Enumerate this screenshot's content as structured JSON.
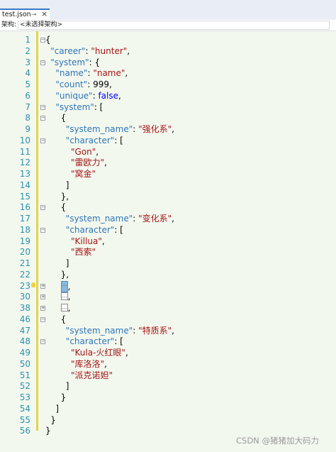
{
  "tab": {
    "title": "test.json",
    "pin_icon": "pin-icon",
    "close_icon": "close-icon"
  },
  "navbar": {
    "label": "架构:",
    "selector_value": "<未选择架构>"
  },
  "lines": [
    {
      "num": "1",
      "fold": "⊟",
      "tokens": [
        {
          "t": "{",
          "c": "n"
        }
      ]
    },
    {
      "num": "2",
      "tokens": [
        {
          "t": "\"career\"",
          "c": "k"
        },
        {
          "t": ": ",
          "c": "n"
        },
        {
          "t": "\"hunter\"",
          "c": "s"
        },
        {
          "t": ",",
          "c": "n"
        }
      ]
    },
    {
      "num": "3",
      "fold": "⊟",
      "tokens": [
        {
          "t": "\"system\"",
          "c": "k"
        },
        {
          "t": ": {",
          "c": "n"
        }
      ]
    },
    {
      "num": "4",
      "tokens": [
        {
          "t": "\"name\"",
          "c": "k"
        },
        {
          "t": ": ",
          "c": "n"
        },
        {
          "t": "\"name\"",
          "c": "s"
        },
        {
          "t": ",",
          "c": "n"
        }
      ]
    },
    {
      "num": "5",
      "tokens": [
        {
          "t": "\"count\"",
          "c": "k"
        },
        {
          "t": ": 999,",
          "c": "n"
        }
      ]
    },
    {
      "num": "6",
      "tokens": [
        {
          "t": "\"unique\"",
          "c": "k"
        },
        {
          "t": ": ",
          "c": "n"
        },
        {
          "t": "false",
          "c": "b"
        },
        {
          "t": ",",
          "c": "n"
        }
      ]
    },
    {
      "num": "7",
      "fold": "⊟",
      "tokens": [
        {
          "t": "\"system\"",
          "c": "k"
        },
        {
          "t": ": [",
          "c": "n"
        }
      ]
    },
    {
      "num": "8",
      "fold": "⊟",
      "tokens": [
        {
          "t": "{",
          "c": "n"
        }
      ]
    },
    {
      "num": "9",
      "tokens": [
        {
          "t": "\"system_name\"",
          "c": "k"
        },
        {
          "t": ": ",
          "c": "n"
        },
        {
          "t": "\"强化系\"",
          "c": "s"
        },
        {
          "t": ",",
          "c": "n"
        }
      ]
    },
    {
      "num": "10",
      "fold": "⊟",
      "tokens": [
        {
          "t": "\"character\"",
          "c": "k"
        },
        {
          "t": ": [",
          "c": "n"
        }
      ]
    },
    {
      "num": "11",
      "tokens": [
        {
          "t": "\"Gon\"",
          "c": "s"
        },
        {
          "t": ",",
          "c": "n"
        }
      ]
    },
    {
      "num": "12",
      "tokens": [
        {
          "t": "\"雷欧力\"",
          "c": "s"
        },
        {
          "t": ",",
          "c": "n"
        }
      ]
    },
    {
      "num": "13",
      "tokens": [
        {
          "t": "\"窝金\"",
          "c": "s"
        }
      ]
    },
    {
      "num": "14",
      "tokens": [
        {
          "t": "]",
          "c": "n"
        }
      ]
    },
    {
      "num": "15",
      "tokens": [
        {
          "t": "},",
          "c": "n"
        }
      ]
    },
    {
      "num": "16",
      "fold": "⊟",
      "tokens": [
        {
          "t": "{",
          "c": "n"
        }
      ]
    },
    {
      "num": "17",
      "tokens": [
        {
          "t": "\"system_name\"",
          "c": "k"
        },
        {
          "t": ": ",
          "c": "n"
        },
        {
          "t": "\"变化系\"",
          "c": "s"
        },
        {
          "t": ",",
          "c": "n"
        }
      ]
    },
    {
      "num": "18",
      "fold": "⊟",
      "tokens": [
        {
          "t": "\"character\"",
          "c": "k"
        },
        {
          "t": ": [",
          "c": "n"
        }
      ]
    },
    {
      "num": "19",
      "tokens": [
        {
          "t": "\"Killua\"",
          "c": "s"
        },
        {
          "t": ",",
          "c": "n"
        }
      ]
    },
    {
      "num": "20",
      "tokens": [
        {
          "t": "\"西索\"",
          "c": "s"
        }
      ]
    },
    {
      "num": "21",
      "tokens": [
        {
          "t": "]",
          "c": "n"
        }
      ]
    },
    {
      "num": "22",
      "tokens": [
        {
          "t": "},",
          "c": "n"
        }
      ]
    },
    {
      "num": "23",
      "fold": "⊞",
      "tokens": [
        {
          "t": "…",
          "c": "collapsed-sel"
        },
        {
          "t": ",",
          "c": "n"
        }
      ]
    },
    {
      "num": "30",
      "fold": "⊞",
      "tokens": [
        {
          "t": "…",
          "c": "collapsed"
        },
        {
          "t": ",",
          "c": "n"
        }
      ]
    },
    {
      "num": "38",
      "fold": "⊞",
      "tokens": [
        {
          "t": "…",
          "c": "collapsed"
        },
        {
          "t": ",",
          "c": "n"
        }
      ]
    },
    {
      "num": "46",
      "fold": "⊟",
      "tokens": [
        {
          "t": "{",
          "c": "n"
        }
      ]
    },
    {
      "num": "47",
      "tokens": [
        {
          "t": "\"system_name\"",
          "c": "k"
        },
        {
          "t": ": ",
          "c": "n"
        },
        {
          "t": "\"特质系\"",
          "c": "s"
        },
        {
          "t": ",",
          "c": "n"
        }
      ]
    },
    {
      "num": "48",
      "fold": "⊟",
      "tokens": [
        {
          "t": "\"character\"",
          "c": "k"
        },
        {
          "t": ": [",
          "c": "n"
        }
      ]
    },
    {
      "num": "49",
      "tokens": [
        {
          "t": "\"Kula-火红眼\"",
          "c": "s"
        },
        {
          "t": ",",
          "c": "n"
        }
      ]
    },
    {
      "num": "50",
      "tokens": [
        {
          "t": "\"库洛洛\"",
          "c": "s"
        },
        {
          "t": ",",
          "c": "n"
        }
      ]
    },
    {
      "num": "51",
      "tokens": [
        {
          "t": "\"派克诺妲\"",
          "c": "s"
        }
      ]
    },
    {
      "num": "52",
      "tokens": [
        {
          "t": "]",
          "c": "n"
        }
      ]
    },
    {
      "num": "53",
      "tokens": [
        {
          "t": "}",
          "c": "n"
        }
      ]
    },
    {
      "num": "54",
      "tokens": [
        {
          "t": "]",
          "c": "n"
        }
      ]
    },
    {
      "num": "55",
      "tokens": [
        {
          "t": "}",
          "c": "n"
        }
      ]
    },
    {
      "num": "56",
      "tokens": [
        {
          "t": "}",
          "c": "n"
        }
      ]
    }
  ],
  "watermark": "CSDN @猪猪加大码力",
  "colors": {
    "key": "#2e75b6",
    "string": "#a31515",
    "keyword": "#0000ff",
    "line_number": "#2b91af",
    "background": "#f3f8ef"
  }
}
